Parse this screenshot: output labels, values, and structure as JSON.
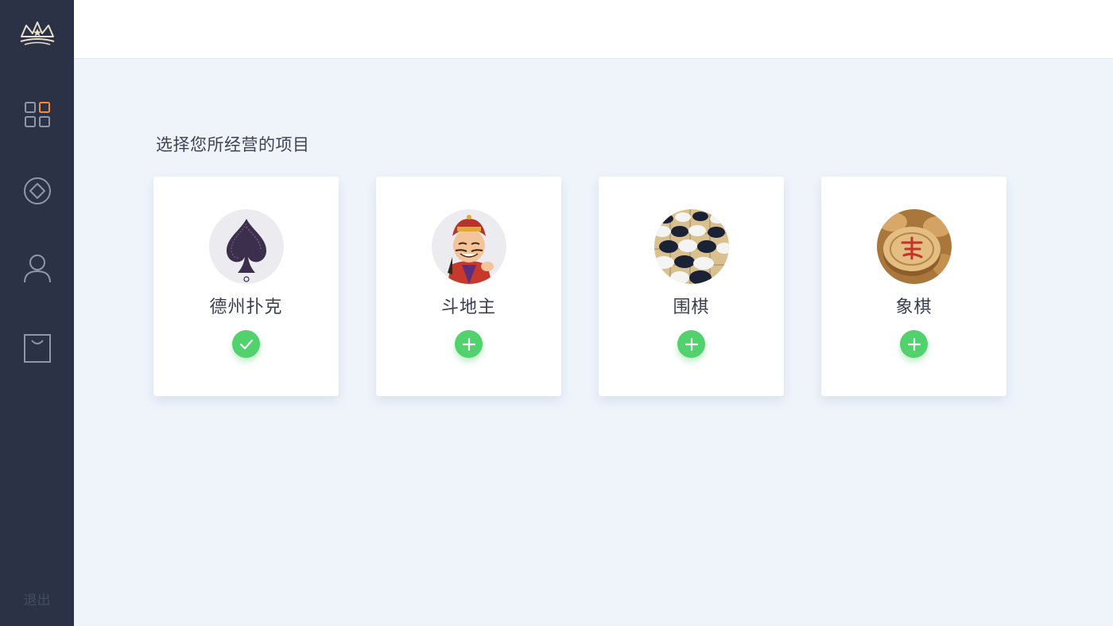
{
  "sidebar": {
    "logo_icon": "crown-cards-logo-icon",
    "nav": [
      {
        "icon": "grid-apps-icon"
      },
      {
        "icon": "diamond-icon"
      },
      {
        "icon": "user-icon"
      },
      {
        "icon": "shopping-bag-icon"
      }
    ],
    "logout_label": "退出"
  },
  "main": {
    "heading": "选择您所经营的项目",
    "cards": [
      {
        "name": "德州扑克",
        "image": "spade-icon",
        "state": "selected",
        "button_icon": "check-icon"
      },
      {
        "name": "斗地主",
        "image": "landlord-character-avatar",
        "state": "add",
        "button_icon": "plus-icon"
      },
      {
        "name": "围棋",
        "image": "go-stones-image",
        "state": "add",
        "button_icon": "plus-icon"
      },
      {
        "name": "象棋",
        "image": "chinese-chess-piece-image",
        "state": "add",
        "button_icon": "plus-icon"
      }
    ]
  },
  "colors": {
    "sidebar_bg": "#2b3246",
    "page_bg": "#eff4fb",
    "accent_orange": "#f58b3c",
    "icon_gray": "#8f96a8",
    "button_green": "#52d26c",
    "card_bg": "#ffffff"
  }
}
